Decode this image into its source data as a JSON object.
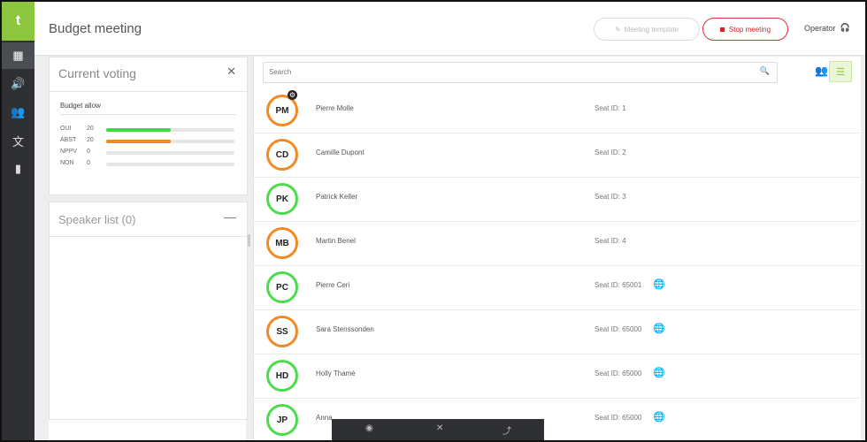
{
  "app": {
    "logo_glyph": "t",
    "accent": "#8cc63f"
  },
  "rail": {
    "items": [
      {
        "icon": "dashboard-icon",
        "glyph": "▦"
      },
      {
        "icon": "speaker-icon",
        "glyph": "🔊"
      },
      {
        "icon": "users-icon",
        "glyph": "👥"
      },
      {
        "icon": "translate-icon",
        "glyph": "文"
      },
      {
        "icon": "document-icon",
        "glyph": "▮"
      }
    ]
  },
  "header": {
    "title": "Budget meeting",
    "template_button": "Meeting template",
    "stop_button": "Stop meeting",
    "operator_label": "Operator",
    "stop_color": "#d8232a"
  },
  "voting": {
    "title": "Current voting",
    "subject": "Budget allow",
    "rows": [
      {
        "label": "OUI",
        "count": "20",
        "fraction": 0.5,
        "color": "#3ddc3d"
      },
      {
        "label": "ABST",
        "count": "20",
        "fraction": 0.5,
        "color": "#f08a24"
      },
      {
        "label": "NPPV",
        "count": "0",
        "fraction": 0,
        "color": "#e6e6e6"
      },
      {
        "label": "NON",
        "count": "0",
        "fraction": 0,
        "color": "#e6e6e6"
      }
    ]
  },
  "speakers": {
    "title": "Speaker list (0)",
    "collapse": "—"
  },
  "search": {
    "placeholder": "Search"
  },
  "participants": [
    {
      "initials": "PM",
      "name": "Pierre Molle",
      "seat": "Seat ID: 1",
      "status": "orange",
      "badge": true,
      "globe": false
    },
    {
      "initials": "CD",
      "name": "Camille Dupont",
      "seat": "Seat ID: 2",
      "status": "orange",
      "badge": false,
      "globe": false
    },
    {
      "initials": "PK",
      "name": "Patrick Keller",
      "seat": "Seat ID: 3",
      "status": "green",
      "badge": false,
      "globe": false
    },
    {
      "initials": "MB",
      "name": "Martin Benel",
      "seat": "Seat ID: 4",
      "status": "orange",
      "badge": false,
      "globe": false
    },
    {
      "initials": "PC",
      "name": "Pierre Ceri",
      "seat": "Seat ID: 65001",
      "status": "green",
      "badge": false,
      "globe": true
    },
    {
      "initials": "SS",
      "name": "Sara Stenssonden",
      "seat": "Seat ID: 65000",
      "status": "orange",
      "badge": false,
      "globe": true
    },
    {
      "initials": "HD",
      "name": "Holly Thamé",
      "seat": "Seat ID: 65000",
      "status": "green",
      "badge": false,
      "globe": true
    },
    {
      "initials": "JP",
      "name": "Anna",
      "seat": "Seat ID: 65000",
      "status": "green",
      "badge": false,
      "globe": true
    }
  ],
  "floatbar": [
    {
      "icon": "record-icon",
      "glyph": "◉"
    },
    {
      "icon": "close-icon",
      "glyph": "✕"
    },
    {
      "icon": "share-icon",
      "glyph": "⤴"
    }
  ]
}
